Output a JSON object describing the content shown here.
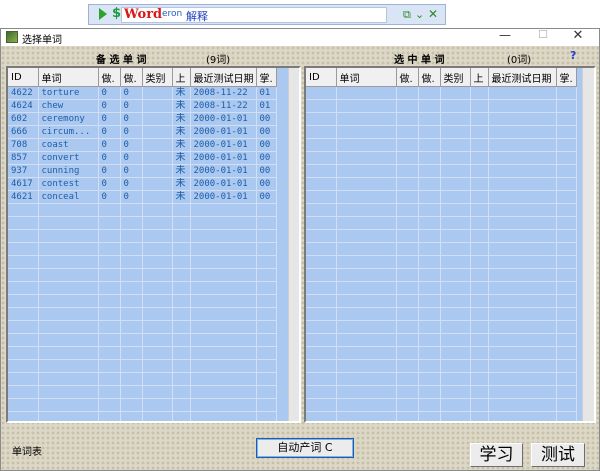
{
  "toolbar": {
    "word": "Word",
    "suffix": "eron",
    "explain": "解释",
    "dollar": "$",
    "restore_glyph": "⧉",
    "dropdown_glyph": "⌄",
    "close_glyph": "✕"
  },
  "window": {
    "title": "选择单词",
    "min_glyph": "—",
    "max_glyph": "☐",
    "close_glyph": "✕"
  },
  "candidate": {
    "heading": "备 选 单 词",
    "count": "(9词)",
    "columns": [
      "ID",
      "单词",
      "做.",
      "做.",
      "类别",
      "上",
      "最近测试日期",
      "掌."
    ],
    "rows": [
      [
        "4622",
        "torture",
        "0",
        "0",
        "",
        "未",
        "2008-11-22",
        "01"
      ],
      [
        "4624",
        "chew",
        "0",
        "0",
        "",
        "未",
        "2008-11-22",
        "01"
      ],
      [
        "602",
        "ceremony",
        "0",
        "0",
        "",
        "未",
        "2000-01-01",
        "00"
      ],
      [
        "666",
        "circum...",
        "0",
        "0",
        "",
        "未",
        "2000-01-01",
        "00"
      ],
      [
        "708",
        "coast",
        "0",
        "0",
        "",
        "未",
        "2000-01-01",
        "00"
      ],
      [
        "857",
        "convert",
        "0",
        "0",
        "",
        "未",
        "2000-01-01",
        "00"
      ],
      [
        "937",
        "cunning",
        "0",
        "0",
        "",
        "未",
        "2000-01-01",
        "00"
      ],
      [
        "4617",
        "contest",
        "0",
        "0",
        "",
        "未",
        "2000-01-01",
        "00"
      ],
      [
        "4621",
        "conceal",
        "0",
        "0",
        "",
        "未",
        "2000-01-01",
        "00"
      ]
    ]
  },
  "selected": {
    "heading": "选 中 单 词",
    "count": "(0词)",
    "columns": [
      "ID",
      "单词",
      "做.",
      "做.",
      "类别",
      "上",
      "最近测试日期",
      "掌."
    ],
    "rows": []
  },
  "help_glyph": "?",
  "bottom": {
    "table_label": "单词表",
    "auto_button": "自动产词 C",
    "study_button": "学习",
    "test_button": "测试"
  }
}
